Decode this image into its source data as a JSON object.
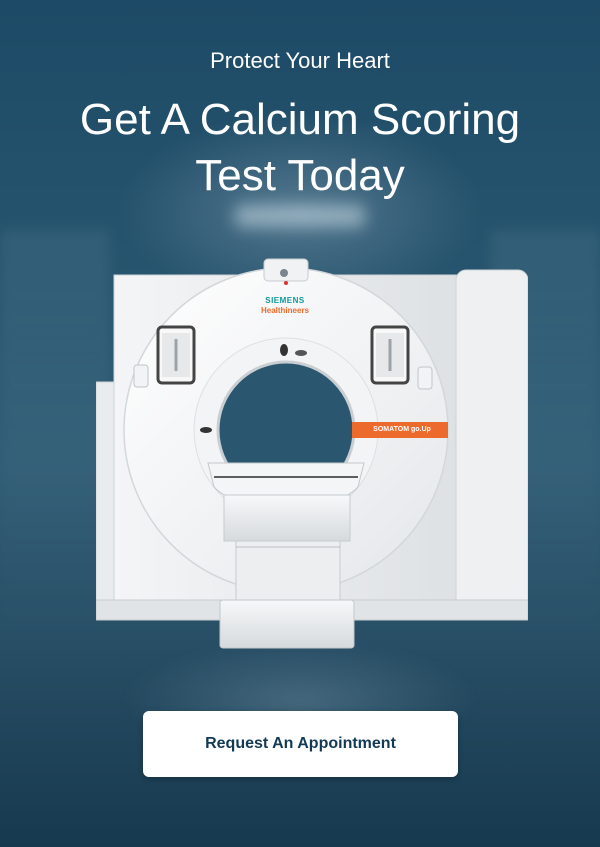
{
  "hero": {
    "subtitle": "Protect Your Heart",
    "title_line1": "Get A Calcium Scoring",
    "title_line2": "Test Today"
  },
  "scanner": {
    "brand_top": "SIEMENS",
    "brand_bottom": "Healthineers",
    "model_label": "SOMATOM go.Up"
  },
  "cta": {
    "label": "Request An Appointment"
  },
  "colors": {
    "background": "#24506a",
    "accent_orange": "#ec6a2c",
    "cta_text": "#123a54"
  }
}
